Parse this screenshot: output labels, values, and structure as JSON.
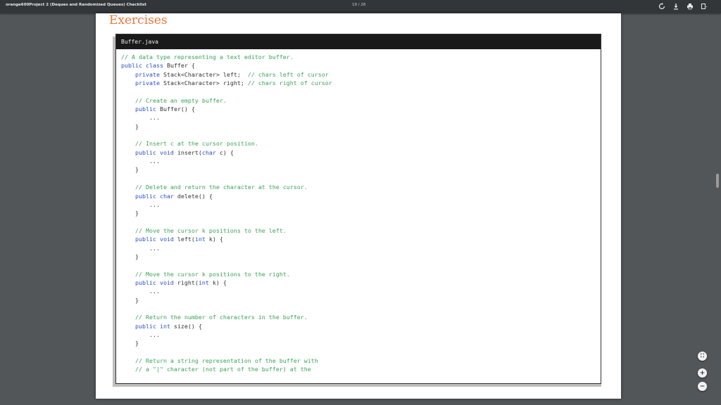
{
  "toolbar": {
    "title": "orange600Project 2 (Deques and Randomized Queues) Checklist",
    "page_indicator": "19 / 26",
    "icons": [
      "rotate-icon",
      "download-icon",
      "print-icon",
      "more-icon"
    ]
  },
  "document": {
    "heading": "Exercises",
    "code_box": {
      "filename": "Buffer.java",
      "lines": [
        [
          [
            "c",
            "// A data type representing a text editor buffer."
          ]
        ],
        [
          [
            "k",
            "public class"
          ],
          [
            "t",
            " Buffer {"
          ]
        ],
        [
          [
            "t",
            "    "
          ],
          [
            "k",
            "private"
          ],
          [
            "t",
            " Stack<Character> left;  "
          ],
          [
            "c",
            "// chars left of cursor"
          ]
        ],
        [
          [
            "t",
            "    "
          ],
          [
            "k",
            "private"
          ],
          [
            "t",
            " Stack<Character> right; "
          ],
          [
            "c",
            "// chars right of cursor"
          ]
        ],
        [],
        [
          [
            "t",
            "    "
          ],
          [
            "c",
            "// Create an empty buffer."
          ]
        ],
        [
          [
            "t",
            "    "
          ],
          [
            "k",
            "public"
          ],
          [
            "t",
            " Buffer() {"
          ]
        ],
        [
          [
            "t",
            "        ..."
          ]
        ],
        [
          [
            "t",
            "    }"
          ]
        ],
        [],
        [
          [
            "t",
            "    "
          ],
          [
            "c",
            "// Insert c at the cursor position."
          ]
        ],
        [
          [
            "t",
            "    "
          ],
          [
            "k",
            "public void"
          ],
          [
            "t",
            " insert("
          ],
          [
            "k",
            "char"
          ],
          [
            "t",
            " c) {"
          ]
        ],
        [
          [
            "t",
            "        ..."
          ]
        ],
        [
          [
            "t",
            "    }"
          ]
        ],
        [],
        [
          [
            "t",
            "    "
          ],
          [
            "c",
            "// Delete and return the character at the cursor."
          ]
        ],
        [
          [
            "t",
            "    "
          ],
          [
            "k",
            "public char"
          ],
          [
            "t",
            " delete() {"
          ]
        ],
        [
          [
            "t",
            "        ..."
          ]
        ],
        [
          [
            "t",
            "    }"
          ]
        ],
        [],
        [
          [
            "t",
            "    "
          ],
          [
            "c",
            "// Move the cursor k positions to the left."
          ]
        ],
        [
          [
            "t",
            "    "
          ],
          [
            "k",
            "public void"
          ],
          [
            "t",
            " left("
          ],
          [
            "k",
            "int"
          ],
          [
            "t",
            " k) {"
          ]
        ],
        [
          [
            "t",
            "        ..."
          ]
        ],
        [
          [
            "t",
            "    }"
          ]
        ],
        [],
        [
          [
            "t",
            "    "
          ],
          [
            "c",
            "// Move the cursor k positions to the right."
          ]
        ],
        [
          [
            "t",
            "    "
          ],
          [
            "k",
            "public void"
          ],
          [
            "t",
            " right("
          ],
          [
            "k",
            "int"
          ],
          [
            "t",
            " k) {"
          ]
        ],
        [
          [
            "t",
            "        ..."
          ]
        ],
        [
          [
            "t",
            "    }"
          ]
        ],
        [],
        [
          [
            "t",
            "    "
          ],
          [
            "c",
            "// Return the number of characters in the buffer."
          ]
        ],
        [
          [
            "t",
            "    "
          ],
          [
            "k",
            "public int"
          ],
          [
            "t",
            " size() {"
          ]
        ],
        [
          [
            "t",
            "        ..."
          ]
        ],
        [
          [
            "t",
            "    }"
          ]
        ],
        [],
        [
          [
            "t",
            "    "
          ],
          [
            "c",
            "// Return a string representation of the buffer with"
          ]
        ],
        [
          [
            "t",
            "    "
          ],
          [
            "c",
            "// a \"|\" character (not part of the buffer) at the"
          ]
        ]
      ]
    }
  },
  "controls": {
    "fit_label": "⛶",
    "zoom_in_label": "+",
    "zoom_out_label": "−"
  },
  "colors": {
    "heading": "#f0763c",
    "comment": "#3aa35a",
    "keyword": "#2b4fc8",
    "toolbar": "#323639",
    "viewer_bg": "#525659"
  }
}
